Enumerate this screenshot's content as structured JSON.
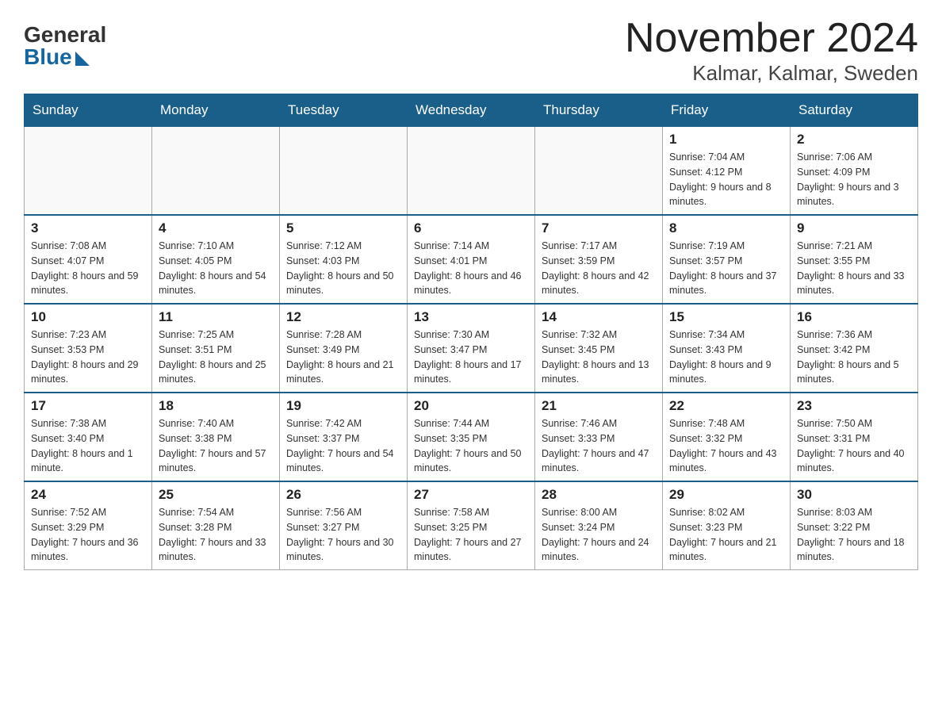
{
  "logo": {
    "general": "General",
    "blue": "Blue"
  },
  "title": {
    "month_year": "November 2024",
    "location": "Kalmar, Kalmar, Sweden"
  },
  "headers": [
    "Sunday",
    "Monday",
    "Tuesday",
    "Wednesday",
    "Thursday",
    "Friday",
    "Saturday"
  ],
  "weeks": [
    [
      {
        "day": "",
        "info": ""
      },
      {
        "day": "",
        "info": ""
      },
      {
        "day": "",
        "info": ""
      },
      {
        "day": "",
        "info": ""
      },
      {
        "day": "",
        "info": ""
      },
      {
        "day": "1",
        "info": "Sunrise: 7:04 AM\nSunset: 4:12 PM\nDaylight: 9 hours and 8 minutes."
      },
      {
        "day": "2",
        "info": "Sunrise: 7:06 AM\nSunset: 4:09 PM\nDaylight: 9 hours and 3 minutes."
      }
    ],
    [
      {
        "day": "3",
        "info": "Sunrise: 7:08 AM\nSunset: 4:07 PM\nDaylight: 8 hours and 59 minutes."
      },
      {
        "day": "4",
        "info": "Sunrise: 7:10 AM\nSunset: 4:05 PM\nDaylight: 8 hours and 54 minutes."
      },
      {
        "day": "5",
        "info": "Sunrise: 7:12 AM\nSunset: 4:03 PM\nDaylight: 8 hours and 50 minutes."
      },
      {
        "day": "6",
        "info": "Sunrise: 7:14 AM\nSunset: 4:01 PM\nDaylight: 8 hours and 46 minutes."
      },
      {
        "day": "7",
        "info": "Sunrise: 7:17 AM\nSunset: 3:59 PM\nDaylight: 8 hours and 42 minutes."
      },
      {
        "day": "8",
        "info": "Sunrise: 7:19 AM\nSunset: 3:57 PM\nDaylight: 8 hours and 37 minutes."
      },
      {
        "day": "9",
        "info": "Sunrise: 7:21 AM\nSunset: 3:55 PM\nDaylight: 8 hours and 33 minutes."
      }
    ],
    [
      {
        "day": "10",
        "info": "Sunrise: 7:23 AM\nSunset: 3:53 PM\nDaylight: 8 hours and 29 minutes."
      },
      {
        "day": "11",
        "info": "Sunrise: 7:25 AM\nSunset: 3:51 PM\nDaylight: 8 hours and 25 minutes."
      },
      {
        "day": "12",
        "info": "Sunrise: 7:28 AM\nSunset: 3:49 PM\nDaylight: 8 hours and 21 minutes."
      },
      {
        "day": "13",
        "info": "Sunrise: 7:30 AM\nSunset: 3:47 PM\nDaylight: 8 hours and 17 minutes."
      },
      {
        "day": "14",
        "info": "Sunrise: 7:32 AM\nSunset: 3:45 PM\nDaylight: 8 hours and 13 minutes."
      },
      {
        "day": "15",
        "info": "Sunrise: 7:34 AM\nSunset: 3:43 PM\nDaylight: 8 hours and 9 minutes."
      },
      {
        "day": "16",
        "info": "Sunrise: 7:36 AM\nSunset: 3:42 PM\nDaylight: 8 hours and 5 minutes."
      }
    ],
    [
      {
        "day": "17",
        "info": "Sunrise: 7:38 AM\nSunset: 3:40 PM\nDaylight: 8 hours and 1 minute."
      },
      {
        "day": "18",
        "info": "Sunrise: 7:40 AM\nSunset: 3:38 PM\nDaylight: 7 hours and 57 minutes."
      },
      {
        "day": "19",
        "info": "Sunrise: 7:42 AM\nSunset: 3:37 PM\nDaylight: 7 hours and 54 minutes."
      },
      {
        "day": "20",
        "info": "Sunrise: 7:44 AM\nSunset: 3:35 PM\nDaylight: 7 hours and 50 minutes."
      },
      {
        "day": "21",
        "info": "Sunrise: 7:46 AM\nSunset: 3:33 PM\nDaylight: 7 hours and 47 minutes."
      },
      {
        "day": "22",
        "info": "Sunrise: 7:48 AM\nSunset: 3:32 PM\nDaylight: 7 hours and 43 minutes."
      },
      {
        "day": "23",
        "info": "Sunrise: 7:50 AM\nSunset: 3:31 PM\nDaylight: 7 hours and 40 minutes."
      }
    ],
    [
      {
        "day": "24",
        "info": "Sunrise: 7:52 AM\nSunset: 3:29 PM\nDaylight: 7 hours and 36 minutes."
      },
      {
        "day": "25",
        "info": "Sunrise: 7:54 AM\nSunset: 3:28 PM\nDaylight: 7 hours and 33 minutes."
      },
      {
        "day": "26",
        "info": "Sunrise: 7:56 AM\nSunset: 3:27 PM\nDaylight: 7 hours and 30 minutes."
      },
      {
        "day": "27",
        "info": "Sunrise: 7:58 AM\nSunset: 3:25 PM\nDaylight: 7 hours and 27 minutes."
      },
      {
        "day": "28",
        "info": "Sunrise: 8:00 AM\nSunset: 3:24 PM\nDaylight: 7 hours and 24 minutes."
      },
      {
        "day": "29",
        "info": "Sunrise: 8:02 AM\nSunset: 3:23 PM\nDaylight: 7 hours and 21 minutes."
      },
      {
        "day": "30",
        "info": "Sunrise: 8:03 AM\nSunset: 3:22 PM\nDaylight: 7 hours and 18 minutes."
      }
    ]
  ]
}
